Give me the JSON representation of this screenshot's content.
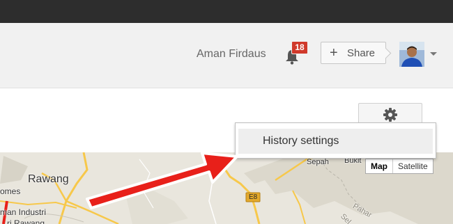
{
  "header": {
    "user_name": "Aman Firdaus",
    "notification_count": "18",
    "share_label": "Share",
    "share_plus": "+"
  },
  "toolbar": {
    "settings_icon": "gear-icon"
  },
  "menu": {
    "items": [
      {
        "label": "History settings"
      }
    ]
  },
  "map": {
    "labels": [
      "Rawang",
      "omes",
      "man Industri",
      "ri Rawang",
      "Sepah",
      "Bukit",
      "E8",
      "Pahar",
      "Sel"
    ],
    "type_controls": [
      "Map",
      "Satellite"
    ],
    "active_type": "Map"
  },
  "colors": {
    "topbar": "#2d2d2d",
    "header_bg": "#f1f1f1",
    "badge": "#d0392b",
    "road": "#f5c542",
    "map_bg": "#e9e6dd",
    "annotation_arrow": "#e8201a"
  }
}
